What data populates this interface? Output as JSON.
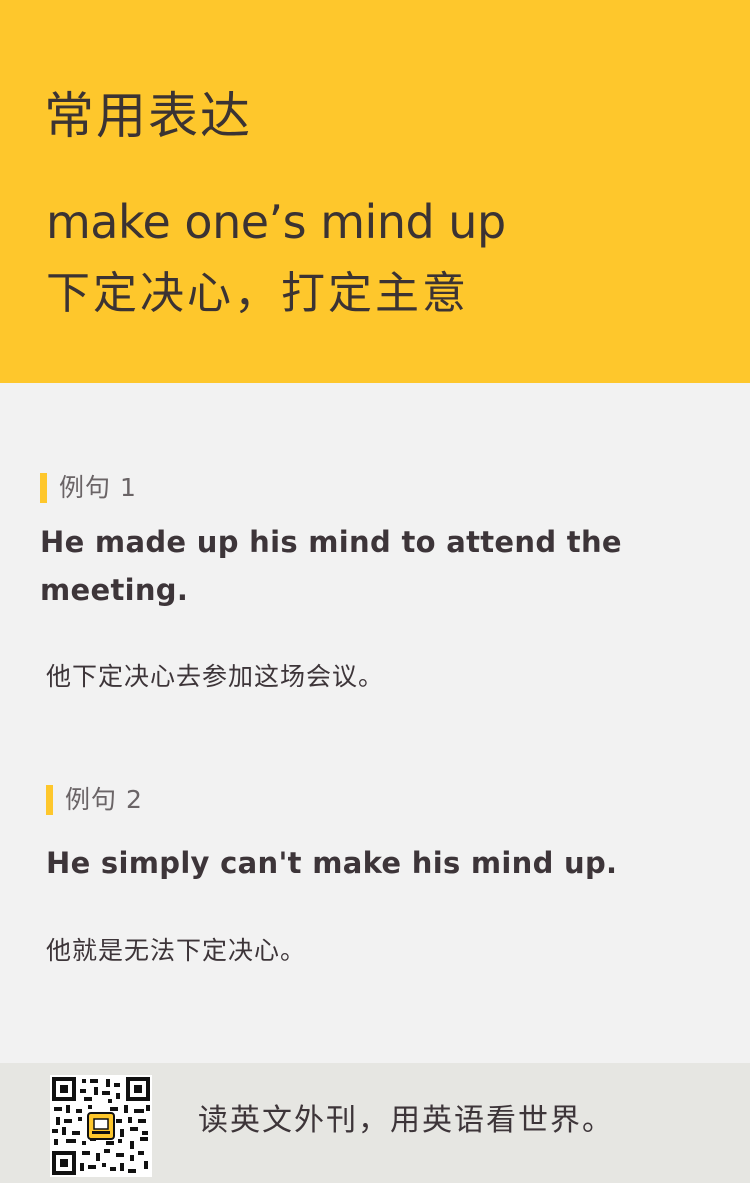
{
  "header": {
    "section_title": "常用表达",
    "phrase": "make one’s mind up",
    "meaning": "下定决心，打定主意"
  },
  "examples": [
    {
      "label": "例句 1",
      "english": "He made up his mind to attend the meeting.",
      "chinese": "他下定决心去参加这场会议。"
    },
    {
      "label": "例句 2",
      "english": "He simply can't make his mind up.",
      "chinese": "他就是无法下定决心。"
    }
  ],
  "footer": {
    "slogan": "读英文外刊，用英语看世界。",
    "qr_icon": "qr-code-icon"
  },
  "colors": {
    "accent": "#fec72c",
    "text": "#3d3539",
    "background": "#f2f2f2",
    "footer_bg": "#e6e6e2"
  }
}
